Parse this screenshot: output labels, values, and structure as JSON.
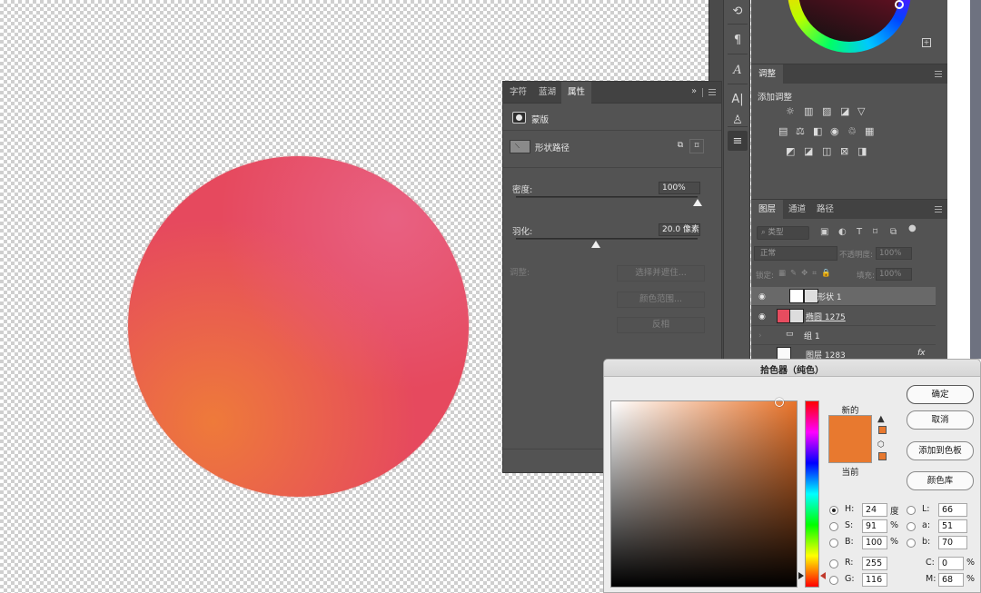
{
  "canvas": {
    "artwork": "gradient circle"
  },
  "tools": {
    "icons": [
      "history-icon",
      "paragraph-icon",
      "character-style-icon",
      "text-direction-icon",
      "stamp-icon",
      "adjustments-sliders-icon"
    ],
    "glyphs": [
      "⟲",
      "¶",
      "A",
      "A|",
      "♙",
      "≡"
    ]
  },
  "properties_panel": {
    "tabs": [
      "字符",
      "蓝湖",
      "属性"
    ],
    "active_tab": "属性",
    "collapse_glyph": "»",
    "mask_label": "蒙版",
    "path_label": "形状路径",
    "density_label": "密度:",
    "density_value": "100%",
    "density_fraction": 1.0,
    "feather_label": "羽化:",
    "feather_value": "20.0 像素",
    "feather_fraction": 0.44,
    "adjust_label": "调整:",
    "buttons": [
      "选择并遮住...",
      "颜色范围...",
      "反相"
    ]
  },
  "adjustments_panel": {
    "tab": "调整",
    "title": "添加调整",
    "row1_glyphs": [
      "☼",
      "▥",
      "▨",
      "◪",
      "▽"
    ],
    "row2_glyphs": [
      "▤",
      "⚖",
      "◧",
      "◉",
      "♲",
      "▦"
    ],
    "row3_glyphs": [
      "◩",
      "◪",
      "◫",
      "⊠",
      "◨"
    ]
  },
  "layers_panel": {
    "tabs": [
      "图层",
      "通道",
      "路径"
    ],
    "active_tab": "图层",
    "filter_placeholder": "类型",
    "blend_mode": "正常",
    "opacity_label": "不透明度:",
    "opacity_value": "100%",
    "lock_label": "锁定:",
    "fill_label": "填充:",
    "fill_value": "100%",
    "layers": [
      {
        "name": "形状 1",
        "visible": true,
        "selected": true
      },
      {
        "name": "椭圆 1275",
        "visible": true,
        "selected": false
      },
      {
        "name": "组 1",
        "visible": false,
        "selected": false
      },
      {
        "name": "图层 1283",
        "visible": false,
        "selected": false
      }
    ],
    "fx_label": "fx"
  },
  "color_picker": {
    "title": "拾色器（纯色）",
    "new_label": "新的",
    "current_label": "当前",
    "new_color": "#e8792f",
    "buttons": {
      "ok": "确定",
      "cancel": "取消",
      "add_swatch": "添加到色板",
      "libraries": "颜色库"
    },
    "fields": {
      "H": {
        "label": "H:",
        "value": "24",
        "unit": "度"
      },
      "S": {
        "label": "S:",
        "value": "91",
        "unit": "%"
      },
      "B": {
        "label": "B:",
        "value": "100",
        "unit": "%"
      },
      "R": {
        "label": "R:",
        "value": "255"
      },
      "G": {
        "label": "G:",
        "value": "116"
      },
      "L": {
        "label": "L:",
        "value": "66"
      },
      "a": {
        "label": "a:",
        "value": "51"
      },
      "b": {
        "label": "b:",
        "value": "70"
      },
      "C": {
        "label": "C:",
        "value": "0",
        "unit": "%"
      },
      "M": {
        "label": "M:",
        "value": "68",
        "unit": "%"
      }
    },
    "selected_field": "H"
  }
}
